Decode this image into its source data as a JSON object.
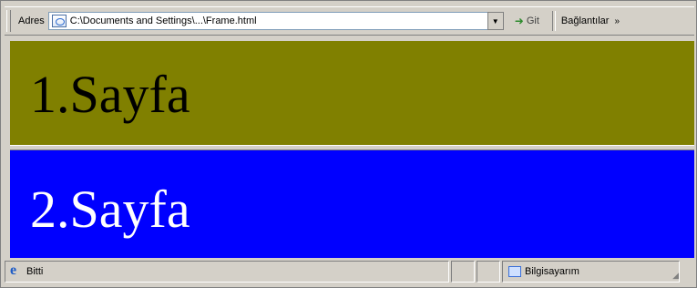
{
  "address_bar": {
    "label": "Adres",
    "url": "C:\\Documents and Settings\\...\\Frame.html",
    "go_label": "Git",
    "links_label": "Bağlantılar",
    "chevron": "»"
  },
  "frames": [
    {
      "text": "1.Sayfa",
      "background": "#808000",
      "text_color": "#000000"
    },
    {
      "text": "2.Sayfa",
      "background": "#0000ff",
      "text_color": "#ffffff"
    }
  ],
  "status_bar": {
    "status_text": "Bitti",
    "zone_text": "Bilgisayarım"
  },
  "icons": {
    "page": "page-icon",
    "dropdown": "dropdown-arrow-icon",
    "go": "go-arrow-icon",
    "ie": "ie-icon",
    "zone": "my-computer-icon"
  }
}
